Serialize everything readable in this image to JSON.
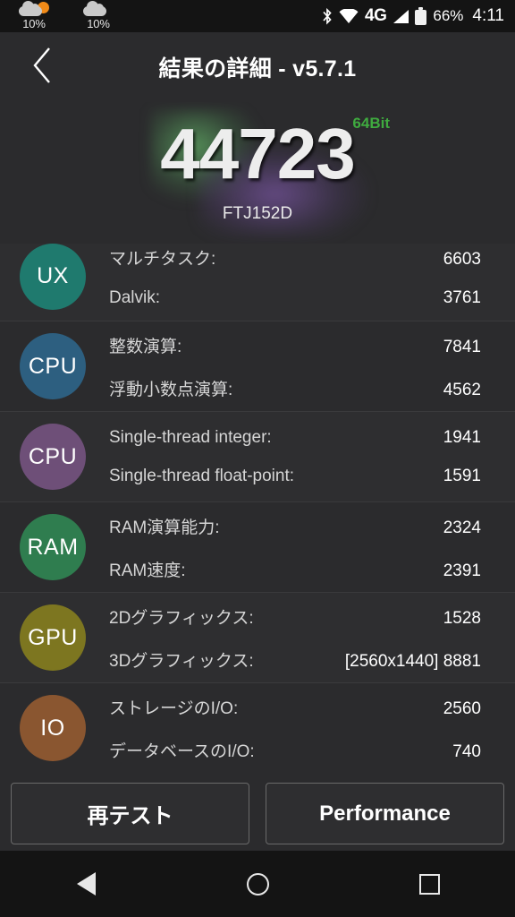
{
  "status_bar": {
    "weather": [
      {
        "icon": "cloud-sun-icon",
        "value": "10%"
      },
      {
        "icon": "cloud-icon",
        "value": "10%"
      }
    ],
    "bluetooth_icon": "bluetooth-icon",
    "wifi_icon": "wifi-icon",
    "network_label": "4G",
    "signal_icon": "signal-bars-icon",
    "battery_icon": "battery-icon",
    "battery_percent": "66%",
    "time": "4:11"
  },
  "appbar": {
    "back_icon": "chevron-left-icon",
    "title": "結果の詳細 - v5.7.1"
  },
  "score": {
    "value": "44723",
    "bit_badge": "64Bit",
    "device": "FTJ152D",
    "badge_color": "#3faa3f",
    "glow_colors": [
      "#5ca060",
      "#7855a0"
    ]
  },
  "rows": [
    {
      "badge": "UX",
      "badge_color": "#1f7a6e",
      "metrics": [
        {
          "label": "マルチタスク:",
          "value": "6603"
        },
        {
          "label": "Dalvik:",
          "value": "3761"
        }
      ]
    },
    {
      "badge": "CPU",
      "badge_color": "#2d5f80",
      "metrics": [
        {
          "label": "整数演算:",
          "value": "7841"
        },
        {
          "label": "浮動小数点演算:",
          "value": "4562"
        }
      ]
    },
    {
      "badge": "CPU",
      "badge_color": "#6e4f78",
      "metrics": [
        {
          "label": "Single-thread integer:",
          "value": "1941"
        },
        {
          "label": "Single-thread float-point:",
          "value": "1591"
        }
      ]
    },
    {
      "badge": "RAM",
      "badge_color": "#2f7d4f",
      "metrics": [
        {
          "label": "RAM演算能力:",
          "value": "2324"
        },
        {
          "label": "RAM速度:",
          "value": "2391"
        }
      ]
    },
    {
      "badge": "GPU",
      "badge_color": "#7d7620",
      "metrics": [
        {
          "label": "2Dグラフィックス:",
          "value": "1528"
        },
        {
          "label": "3Dグラフィックス:",
          "value": "[2560x1440] 8881"
        }
      ]
    },
    {
      "badge": "IO",
      "badge_color": "#8a5630",
      "metrics": [
        {
          "label": "ストレージのI/O:",
          "value": "2560"
        },
        {
          "label": "データベースのI/O:",
          "value": "740"
        }
      ]
    }
  ],
  "buttons": {
    "retest": "再テスト",
    "performance": "Performance"
  },
  "navbar": {
    "back": "back-nav-icon",
    "home": "home-nav-icon",
    "recents": "recents-nav-icon"
  }
}
